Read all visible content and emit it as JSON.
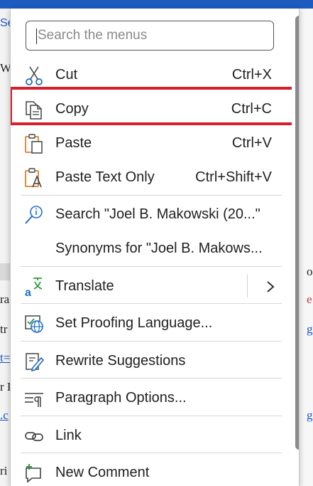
{
  "background": {
    "fragments": [
      "Se",
      "W",
      "ra",
      "tr",
      "t=",
      "r I",
      ".c",
      "ri",
      "o",
      "e",
      "g",
      "g"
    ]
  },
  "menu": {
    "search": {
      "placeholder": "Search the menus"
    },
    "items": [
      {
        "label": "Cut",
        "shortcut": "Ctrl+X",
        "icon": "scissors-icon"
      },
      {
        "label": "Copy",
        "shortcut": "Ctrl+C",
        "icon": "copy-icon"
      },
      {
        "label": "Paste",
        "shortcut": "Ctrl+V",
        "icon": "paste-icon"
      },
      {
        "label": "Paste Text Only",
        "shortcut": "Ctrl+Shift+V",
        "icon": "paste-text-only-icon"
      },
      {
        "label": "Search \"Joel B. Makowski (20...\"",
        "shortcut": "",
        "icon": "search-info-icon"
      },
      {
        "label": "Synonyms for \"Joel B. Makows...",
        "shortcut": "",
        "icon": ""
      },
      {
        "label": "Translate",
        "shortcut": "",
        "icon": "translate-icon"
      },
      {
        "label": "Set Proofing Language...",
        "shortcut": "",
        "icon": "proofing-language-icon"
      },
      {
        "label": "Rewrite Suggestions",
        "shortcut": "",
        "icon": "rewrite-icon"
      },
      {
        "label": "Paragraph Options...",
        "shortcut": "",
        "icon": "paragraph-icon"
      },
      {
        "label": "Link",
        "shortcut": "",
        "icon": "link-icon"
      },
      {
        "label": "New Comment",
        "shortcut": "",
        "icon": "comment-icon"
      }
    ],
    "highlighted_item": "Copy",
    "colors": {
      "highlight_border": "#d6202b",
      "scrollbar": "#8a8a8a",
      "icon_orange": "#d9822b",
      "icon_blue": "#1f6fc5",
      "icon_green": "#2e9b3e"
    }
  }
}
